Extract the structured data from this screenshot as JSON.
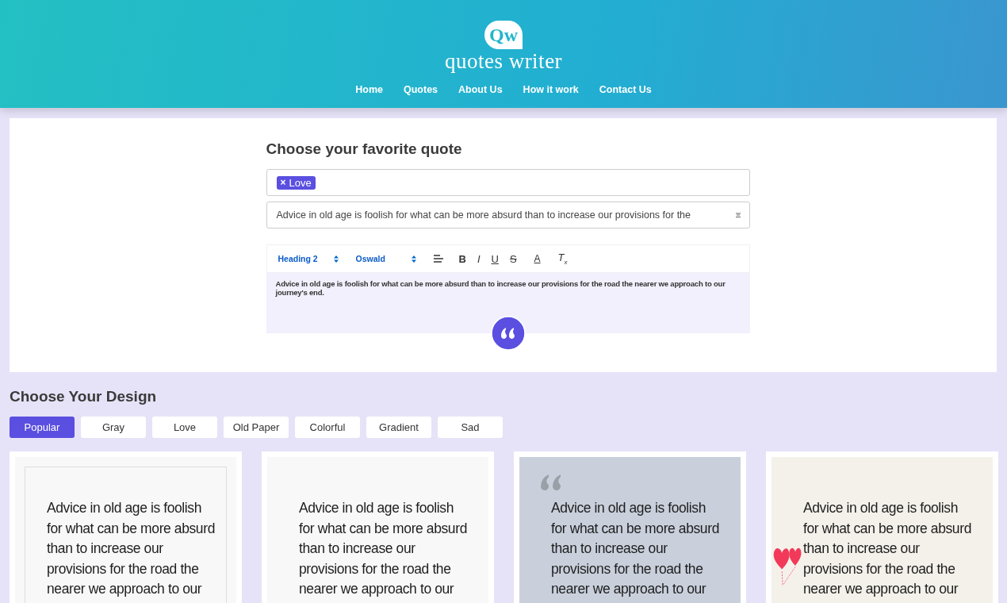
{
  "header": {
    "logo_mark": "Qw",
    "logo_text": "quotes writer",
    "nav": [
      {
        "label": "Home"
      },
      {
        "label": "Quotes"
      },
      {
        "label": "About Us"
      },
      {
        "label": "How it work"
      },
      {
        "label": "Contact Us"
      }
    ]
  },
  "editor_panel": {
    "title": "Choose your favorite quote",
    "tags": [
      {
        "label": "Love",
        "remove": "×"
      }
    ],
    "quote_select": {
      "value": "Advice in old age is foolish for what can be more absurd than to increase our provisions for the"
    },
    "toolbar": [
      {
        "kind": "select",
        "label": "Heading 2"
      },
      {
        "kind": "select",
        "label": "Oswald"
      },
      {
        "kind": "align"
      },
      {
        "kind": "bold",
        "label": "B"
      },
      {
        "kind": "italic",
        "label": "I"
      },
      {
        "kind": "underline",
        "label": "U"
      },
      {
        "kind": "strike",
        "label": "S"
      },
      {
        "kind": "color",
        "label": "A"
      },
      {
        "kind": "clear",
        "label": "T",
        "sub": "x"
      }
    ],
    "body": "Advice in old age is foolish for what can be more absurd than to increase our provisions for the road the nearer we approach to our journey's end."
  },
  "design": {
    "title": "Choose Your Design",
    "tabs": [
      {
        "label": "Popular",
        "selected": true
      },
      {
        "label": "Gray",
        "selected": false
      },
      {
        "label": "Love",
        "selected": false
      },
      {
        "label": "Old Paper",
        "selected": false
      },
      {
        "label": "Colorful",
        "selected": false
      },
      {
        "label": "Gradient",
        "selected": false
      },
      {
        "label": "Sad",
        "selected": false
      }
    ],
    "cards": [
      {
        "kind": "framed",
        "lines": [
          "Advice in old age is foolish",
          "for what can be more absurd",
          "than to increase our",
          "provisions for the road the",
          "nearer we approach to our"
        ]
      },
      {
        "kind": "plain",
        "lines": [
          "Advice in old age is foolish",
          "for what can be more absurd",
          "than to increase our",
          "provisions for the road the",
          "nearer we approach to our"
        ]
      },
      {
        "kind": "gray",
        "lines": [
          "Advice in old age is foolish",
          "for what can be more absurd",
          "than to increase our",
          "provisions for the road the",
          "nearer we approach to our"
        ]
      },
      {
        "kind": "hearts",
        "lines": [
          "Advice in old age is foolish",
          "for what can be more absurd",
          "than to increase our",
          "provisions for the road the",
          "nearer we approach to our"
        ]
      }
    ]
  }
}
